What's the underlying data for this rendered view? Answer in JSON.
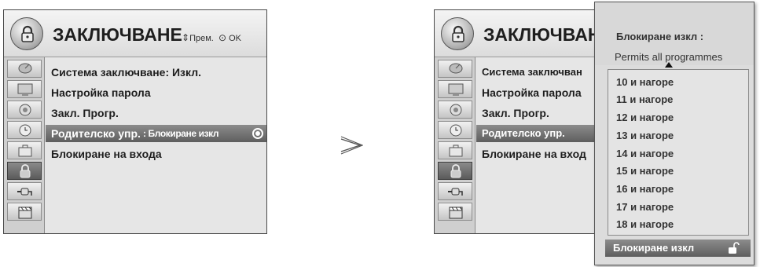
{
  "left_panel": {
    "title": "ЗАКЛЮЧВАНЕ",
    "nav_hint": {
      "move_icon": "four-way-arrow-icon",
      "move_label": "Прем.",
      "ok_icon": "ok-circle-icon",
      "ok_label": "OK"
    },
    "menu": [
      {
        "label": "Система заключване: Изкл."
      },
      {
        "label": "Настройка парола"
      },
      {
        "label": "Закл. Прогр."
      },
      {
        "label": "Родителско упр.",
        "value": ": Блокиране изкл",
        "selected": true
      },
      {
        "label": "Блокиране на входа"
      }
    ]
  },
  "categories": [
    {
      "icon": "satellite-dish-icon"
    },
    {
      "icon": "monitor-icon"
    },
    {
      "icon": "speaker-icon"
    },
    {
      "icon": "clock-icon"
    },
    {
      "icon": "toolbox-icon"
    },
    {
      "icon": "padlock-icon",
      "active": true
    },
    {
      "icon": "connector-plug-icon"
    },
    {
      "icon": "film-clapper-icon"
    }
  ],
  "arrow_symbol": "≫",
  "right_panel": {
    "title": "ЗАКЛЮЧВАНЕ",
    "menu": [
      {
        "label": "Система заключван"
      },
      {
        "label": "Настройка парола"
      },
      {
        "label": "Закл. Прогр."
      },
      {
        "label": "Родителско упр.",
        "selected": true
      },
      {
        "label": "Блокиране на вход"
      }
    ]
  },
  "popup": {
    "title": "Блокиране изкл :",
    "subtitle": "Permits all programmes",
    "options": [
      "10 и нагоре",
      "11 и нагоре",
      "12 и нагоре",
      "13 и нагоре",
      "14 и нагоре",
      "15 и нагоре",
      "16 и нагоре",
      "17 и нагоре",
      "18 и нагоре"
    ],
    "selected_option": "Блокиране изкл",
    "selected_icon": "unlocked-padlock-icon"
  },
  "colors": {
    "selection": "#6e6e6e",
    "panel": "#e6e6e6",
    "border": "#4a4a4a"
  }
}
